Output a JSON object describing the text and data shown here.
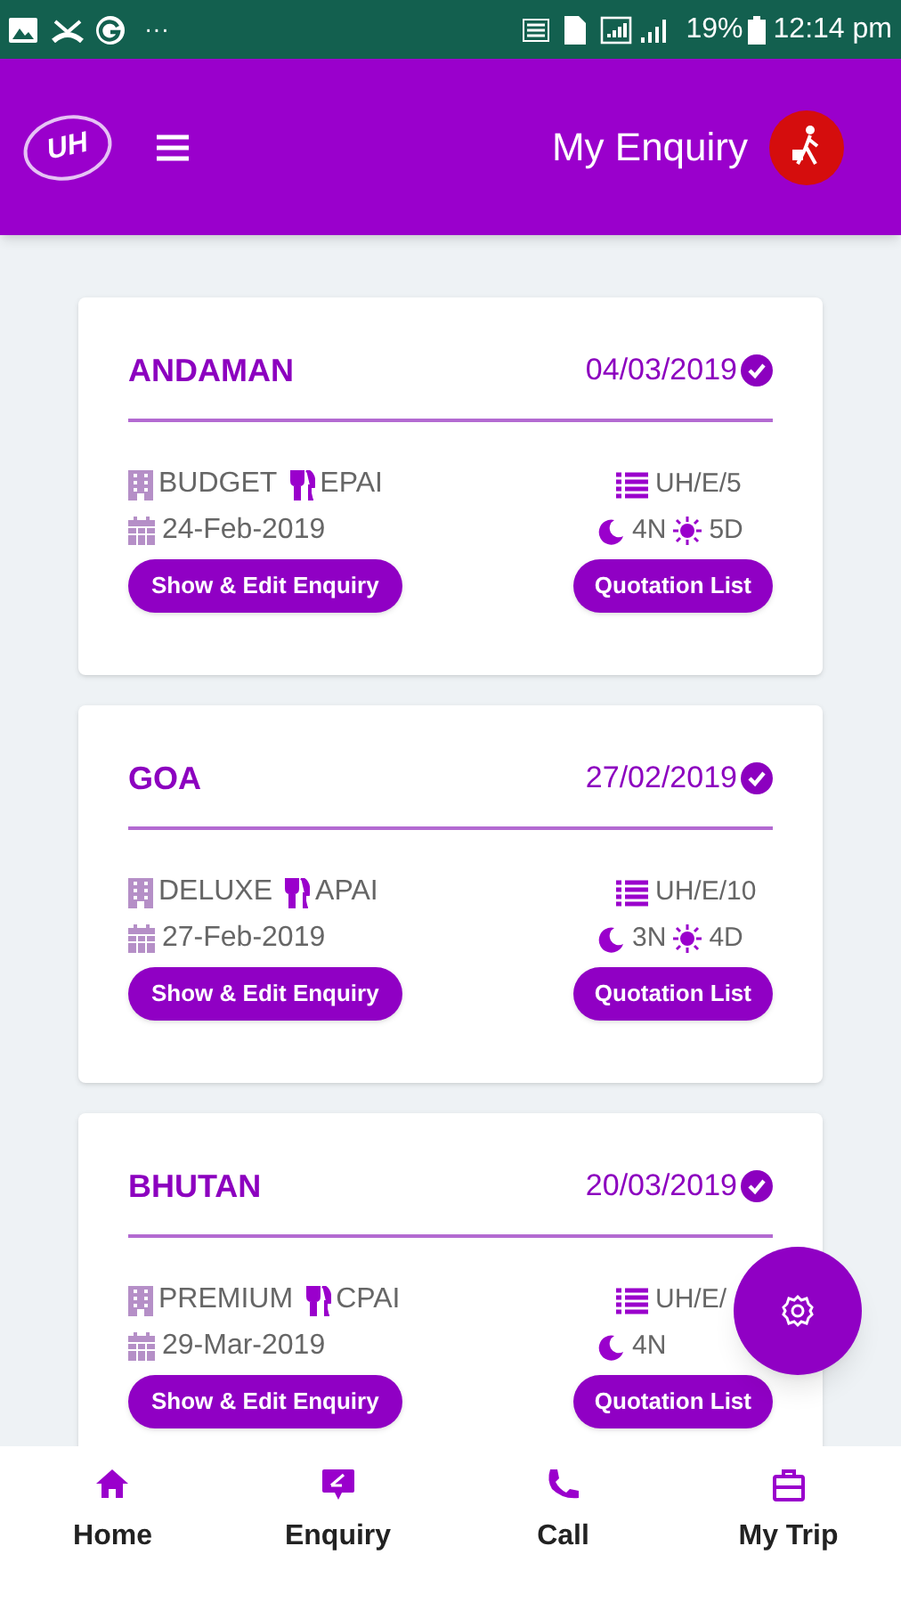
{
  "status_bar": {
    "more": "···",
    "battery": "19%",
    "time": "12:14 pm"
  },
  "header": {
    "title": "My Enquiry",
    "logo": "UH"
  },
  "enquiries": [
    {
      "destination": "ANDAMAN",
      "date": "04/03/2019",
      "confirmed": true,
      "hotel": "BUDGET",
      "meal": "EPAI",
      "reference": "UH/E/5",
      "travel_date": "24-Feb-2019",
      "nights": "4N",
      "days": "5D",
      "buttons": [
        "Show & Edit Enquiry",
        "Quotation List"
      ]
    },
    {
      "destination": "GOA",
      "date": "27/02/2019",
      "confirmed": true,
      "hotel": "DELUXE",
      "meal": "APAI",
      "reference": "UH/E/10",
      "travel_date": "27-Feb-2019",
      "nights": "3N",
      "days": "4D",
      "buttons": [
        "Show & Edit Enquiry",
        "Quotation List"
      ]
    },
    {
      "destination": "BHUTAN",
      "date": "20/03/2019",
      "confirmed": true,
      "hotel": "PREMIUM",
      "meal": "CPAI",
      "reference": "UH/E/",
      "travel_date": "29-Mar-2019",
      "nights": "4N",
      "buttons": [
        "Show & Edit Enquiry",
        "Quotation List"
      ]
    }
  ],
  "bottom_nav": [
    {
      "kind": "home",
      "label": "Home"
    },
    {
      "kind": "enquiry",
      "label": "Enquiry"
    },
    {
      "kind": "call",
      "label": "Call"
    },
    {
      "kind": "trip",
      "label": "My Trip"
    }
  ]
}
